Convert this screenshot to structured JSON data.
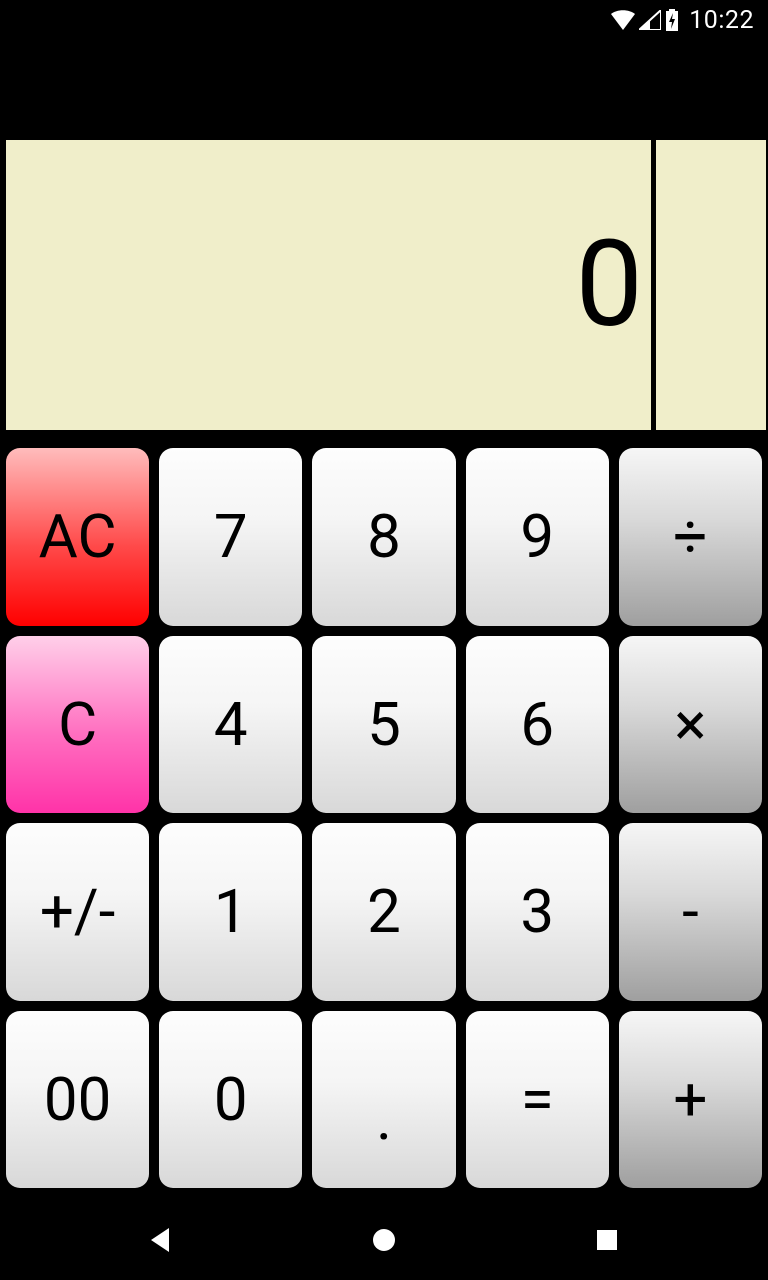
{
  "status": {
    "clock": "10:22"
  },
  "display": {
    "value": "0"
  },
  "keys": {
    "ac": "AC",
    "c": "C",
    "pm": "+/-",
    "dz": "00",
    "d7": "7",
    "d8": "8",
    "d9": "9",
    "d4": "4",
    "d5": "5",
    "d6": "6",
    "d1": "1",
    "d2": "2",
    "d3": "3",
    "d0": "0",
    "dot": ".",
    "eq": "=",
    "div": "÷",
    "mul": "×",
    "sub": "-",
    "add": "+"
  }
}
